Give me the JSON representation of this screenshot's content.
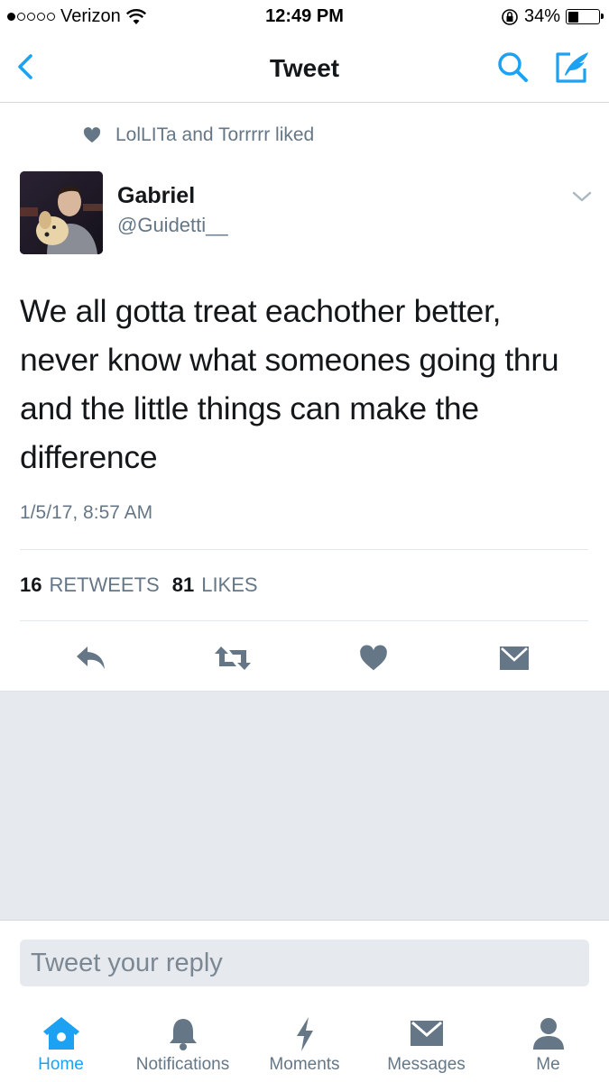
{
  "status_bar": {
    "carrier": "Verizon",
    "time": "12:49 PM",
    "battery": "34%",
    "battery_level": 0.34,
    "signal_bars": 1
  },
  "nav": {
    "title": "Tweet",
    "back_icon": "chevron-left-icon",
    "search_icon": "search-icon",
    "compose_icon": "compose-tweet-icon",
    "accent_color": "#1da1f2"
  },
  "tweet": {
    "social_context": "LolLITa and Torrrrr liked",
    "author": {
      "name": "Gabriel",
      "handle": "@Guidetti__"
    },
    "text": "We all gotta treat eachother better, never know what someones going thru and the little things can make the difference",
    "timestamp": "1/5/17, 8:57 AM",
    "stats": {
      "retweets_count": "16",
      "retweets_label": "RETWEETS",
      "likes_count": "81",
      "likes_label": "LIKES"
    },
    "actions": [
      "reply-icon",
      "retweet-icon",
      "heart-icon",
      "direct-message-icon"
    ]
  },
  "reply": {
    "placeholder": "Tweet your reply"
  },
  "tabs": [
    {
      "label": "Home",
      "icon": "home-icon",
      "active": true
    },
    {
      "label": "Notifications",
      "icon": "bell-icon",
      "active": false
    },
    {
      "label": "Moments",
      "icon": "lightning-icon",
      "active": false
    },
    {
      "label": "Messages",
      "icon": "envelope-icon",
      "active": false
    },
    {
      "label": "Me",
      "icon": "person-icon",
      "active": false
    }
  ]
}
